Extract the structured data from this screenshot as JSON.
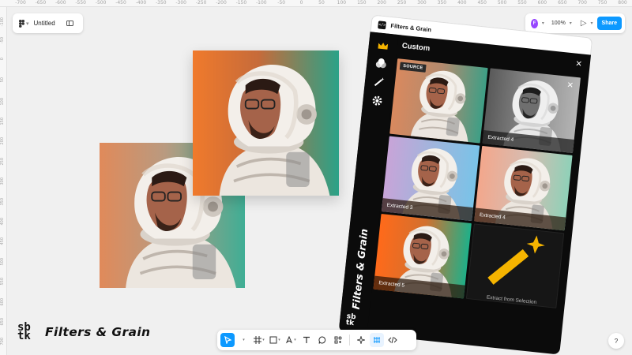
{
  "rulers": {
    "top": [
      "-700",
      "-650",
      "-600",
      "-550",
      "-500",
      "-450",
      "-400",
      "-350",
      "-300",
      "-250",
      "-200",
      "-150",
      "-100",
      "-50",
      "0",
      "50",
      "100",
      "150",
      "200",
      "250",
      "300",
      "350",
      "400",
      "450",
      "500",
      "550",
      "600",
      "650",
      "700",
      "750",
      "800",
      "850"
    ],
    "left": [
      "-100",
      "-50",
      "0",
      "50",
      "100",
      "150",
      "200",
      "250",
      "300",
      "350",
      "400",
      "450",
      "500",
      "550",
      "600",
      "650",
      "700"
    ]
  },
  "file": {
    "menu_icon": "figma-menu-icon",
    "title": "Untitled"
  },
  "header_right": {
    "avatar_initial": "F",
    "zoom": "100%",
    "share_label": "Share"
  },
  "plugin": {
    "window_title": "Filters & Grain",
    "panel_title": "Custom",
    "source_badge": "SOURCE",
    "brand_vertical": "Filters & Grain",
    "mini_logo_top": "sb",
    "mini_logo_bottom": "tk",
    "cells": [
      {
        "label": ""
      },
      {
        "label": "Extracted 4"
      },
      {
        "label": "Extracted 3"
      },
      {
        "label": "Extracted 4"
      },
      {
        "label": "Extracted 5"
      }
    ],
    "extract_label": "Extract from Selection"
  },
  "brand": {
    "mark_top": "sb",
    "mark_bottom": "tk",
    "name": "Filters & Grain"
  },
  "help_label": "?",
  "colors": {
    "accent": "#0d99ff",
    "avatar": "#9747ff",
    "plugin_bg": "#0b0b0b"
  }
}
